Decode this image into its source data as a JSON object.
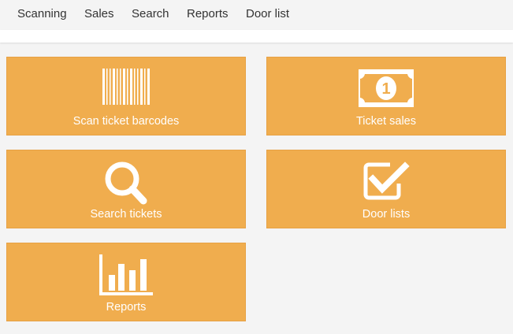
{
  "nav": {
    "items": [
      {
        "label": "Scanning"
      },
      {
        "label": "Sales"
      },
      {
        "label": "Search"
      },
      {
        "label": "Reports"
      },
      {
        "label": "Door list"
      }
    ]
  },
  "tiles": [
    {
      "label": "Scan ticket barcodes",
      "icon": "barcode-icon"
    },
    {
      "label": "Ticket sales",
      "icon": "banknote-icon"
    },
    {
      "label": "Search tickets",
      "icon": "search-icon"
    },
    {
      "label": "Door lists",
      "icon": "checkbox-icon"
    },
    {
      "label": "Reports",
      "icon": "bar-chart-icon"
    }
  ],
  "colors": {
    "tile_background": "#f0ad4e",
    "tile_text": "#ffffff",
    "page_background": "#f4f4f4",
    "nav_text": "#333333"
  }
}
